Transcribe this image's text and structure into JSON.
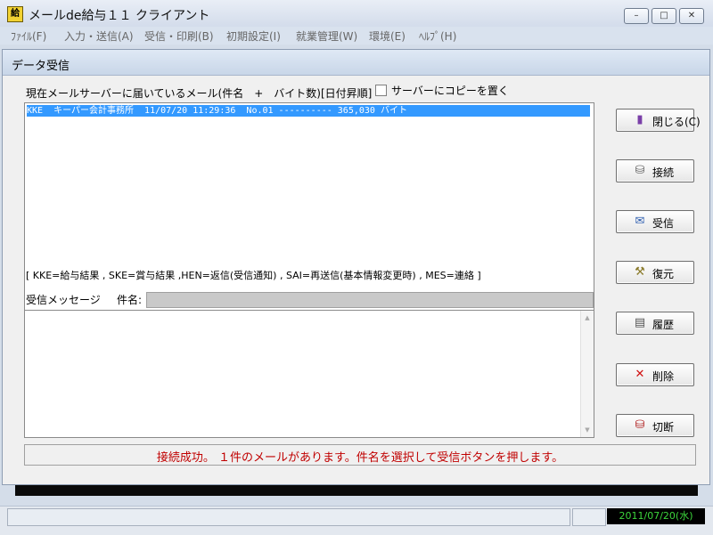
{
  "window": {
    "title": "メールde給与１１ クライアント",
    "icon_text": "給",
    "minimize": "–",
    "maximize": "□",
    "close": "✕"
  },
  "menu": [
    "ﾌｧｲﾙ(F)",
    "入力・送信(A)",
    "受信・印刷(B)",
    "初期設定(I)",
    "就業管理(W)",
    "環境(E)",
    "ﾍﾙﾌﾟ(H)"
  ],
  "dialog": {
    "title": "データ受信",
    "list_caption": "現在メールサーバーに届いているメール(件名　+　バイト数)[日付昇順]",
    "copy_checkbox": {
      "label": "サーバーにコピーを置く",
      "checked": false
    },
    "mail_rows": [
      "KKE  キーパー会計事務所  11/07/20 11:29:36  No.01 ---------- 365,030 バイト"
    ],
    "legend": "[ KKE=給与結果 , SKE=賞与結果 ,HEN=返信(受信通知) , SAI=再送信(基本情報変更時) , MES=連絡 ]",
    "message_caption": "受信メッセージ",
    "subject_label": "件名:",
    "subject_value": "",
    "message_body": "",
    "status_message": "接続成功。 １件のメールがあります。件名を選択して受信ボタンを押します。",
    "buttons": {
      "close": {
        "label": "閉じる(C)",
        "icon": "door-icon",
        "glyph": "▮"
      },
      "connect": {
        "label": "接続",
        "icon": "server-connect-icon",
        "glyph": "⛁"
      },
      "receive": {
        "label": "受信",
        "icon": "mail-receive-icon",
        "glyph": "✉"
      },
      "restore": {
        "label": "復元",
        "icon": "restore-icon",
        "glyph": "⚒"
      },
      "history": {
        "label": "履歴",
        "icon": "history-icon",
        "glyph": "▤"
      },
      "delete": {
        "label": "削除",
        "icon": "delete-icon",
        "glyph": "✕"
      },
      "disconnect": {
        "label": "切断",
        "icon": "server-disconnect-icon",
        "glyph": "⛁"
      }
    }
  },
  "statusbar": {
    "date": "2011/07/20(水)"
  },
  "colors": {
    "selection": "#3399ff",
    "status_text": "#c00000",
    "date_text": "#3cd63c"
  }
}
